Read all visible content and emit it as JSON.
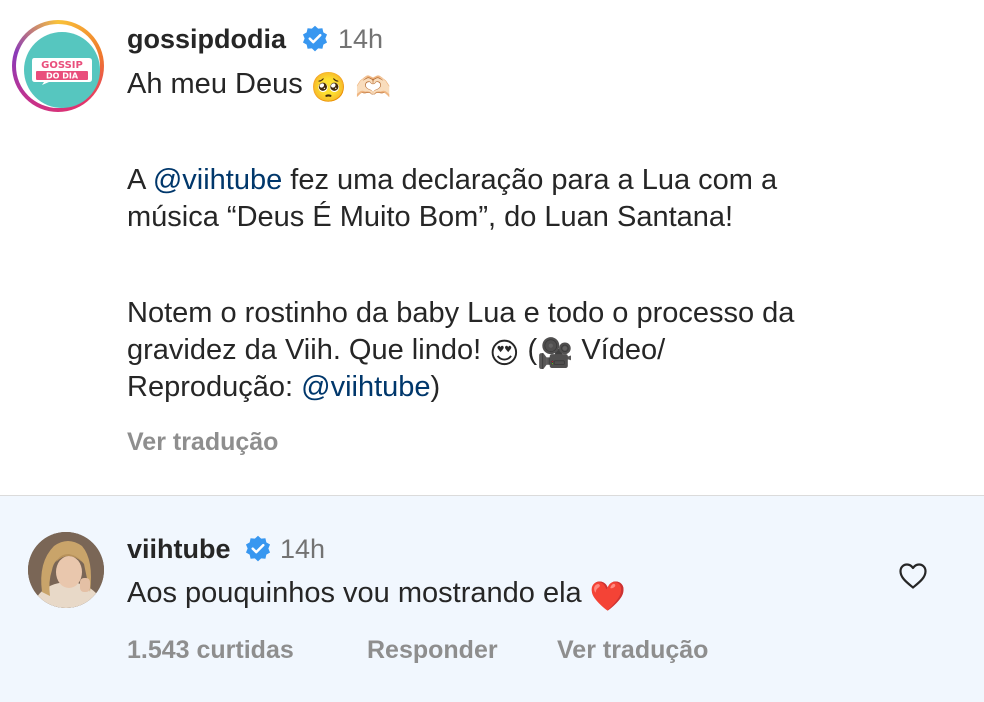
{
  "post": {
    "username": "gossipdodia",
    "verified_icon": "verified-badge-icon",
    "time": "14h",
    "avatar_text": [
      "GOSSIP",
      "DO DIA"
    ],
    "line1": "Ah meu Deus",
    "line1_emojis": [
      "🥺",
      "🫶🏻"
    ],
    "para2_a": "A ",
    "para2_mention": "@viihtube",
    "para2_b": " fez uma declaração para a Lua com a",
    "para2_line2": "música “Deus É Muito Bom”, do Luan Santana!",
    "para3_line1": "Notem o rostinho da baby Lua e todo o processo da",
    "para3_line2_a": "gravidez da Viih. Que lindo! ",
    "para3_emoji1": "😍",
    "para3_line2_b": " (",
    "para3_emoji2": "🎥",
    "para3_line2_c": " Vídeo/",
    "para3_line3_a": "Reprodução: ",
    "para3_mention": "@viihtube",
    "para3_line3_b": ")",
    "translate": "Ver tradução"
  },
  "reply": {
    "username": "viihtube",
    "verified_icon": "verified-badge-icon",
    "time": "14h",
    "text": "Aos pouquinhos vou mostrando ela ",
    "emoji": "❤️",
    "likes": "1.543 curtidas",
    "reply_label": "Responder",
    "translate": "Ver tradução",
    "like_icon": "heart-outline-icon"
  }
}
